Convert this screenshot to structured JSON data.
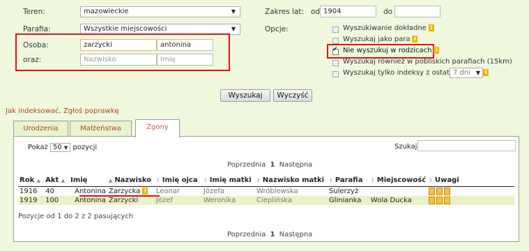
{
  "form": {
    "teren_label": "Teren:",
    "teren_value": "mazowieckie",
    "parafia_label": "Parafia:",
    "parafia_value": "Wszystkie miejscowości",
    "osoba_label": "Osoba:",
    "osoba_surname": "zarzycki",
    "osoba_firstname": "antonina",
    "oraz_label": "oraz:",
    "oraz_surname_placeholder": "Nazwisko",
    "oraz_firstname_placeholder": "Imię",
    "zakres_label": "Zakres lat:",
    "od_label": "od",
    "year_from": "1904",
    "do_label": "do",
    "year_to": "",
    "opcje_label": "Opcje:",
    "options": [
      {
        "label": "Wyszukiwanie dokładne",
        "checked": false,
        "info": true
      },
      {
        "label": "Wyszukaj jako para",
        "checked": false,
        "info": true
      },
      {
        "label": "Nie wyszukuj w rodzicach",
        "checked": true,
        "info": true
      },
      {
        "label": "Wyszukaj również w pobliskich parafiach (15km)",
        "checked": false,
        "info": false
      },
      {
        "label": "Wyszukaj tylko indeksy z ostatnich",
        "checked": false,
        "info": true
      }
    ],
    "days_value": "7 dni",
    "search_button": "Wyszukaj",
    "clear_button": "Wyczyść"
  },
  "links": {
    "how_indexed": "Jak indeksować",
    "separator": ", ",
    "report": "Zgłoś poprawkę"
  },
  "tabs": [
    {
      "label": "Urodzenia",
      "active": false
    },
    {
      "label": "Małżeństwa",
      "active": false
    },
    {
      "label": "Zgony",
      "active": true
    }
  ],
  "results": {
    "show_label": "Pokaż",
    "page_size": "50",
    "entries_label": "pozycji",
    "search_label": "Szukaj:",
    "prev": "Poprzednia",
    "page": "1",
    "next": "Następna",
    "columns": [
      "Rok",
      "Akt",
      "Imię",
      "Nazwisko",
      "Imię ojca",
      "Imię matki",
      "Nazwisko matki",
      "Parafia",
      "Miejscowość",
      "Uwagi"
    ],
    "rows": [
      {
        "rok": "1916",
        "akt": "40",
        "imie": "Antonina",
        "nazwisko": "Zarzycka",
        "imie_ojca": "Leonar",
        "imie_matki": "Józefa",
        "nazwisko_matki": "Wróblewska",
        "parafia": "Sulerzyż",
        "miejscowosc": "",
        "uwagi": "i z a"
      },
      {
        "rok": "1919",
        "akt": "100",
        "imie": "Antonina",
        "nazwisko": "Zarzycki",
        "imie_ojca": "Józef",
        "imie_matki": "Weronika",
        "nazwisko_matki": "Cieplińska",
        "parafia": "Glinianka",
        "miejscowosc": "Wola Ducka",
        "uwagi": "i z a"
      }
    ],
    "summary": "Pozycje od 1 do 2 z 2 pasujących"
  },
  "colors": {
    "highlight": "#e01010",
    "link": "#b0451a",
    "row_alt": "#e7f2c6"
  }
}
